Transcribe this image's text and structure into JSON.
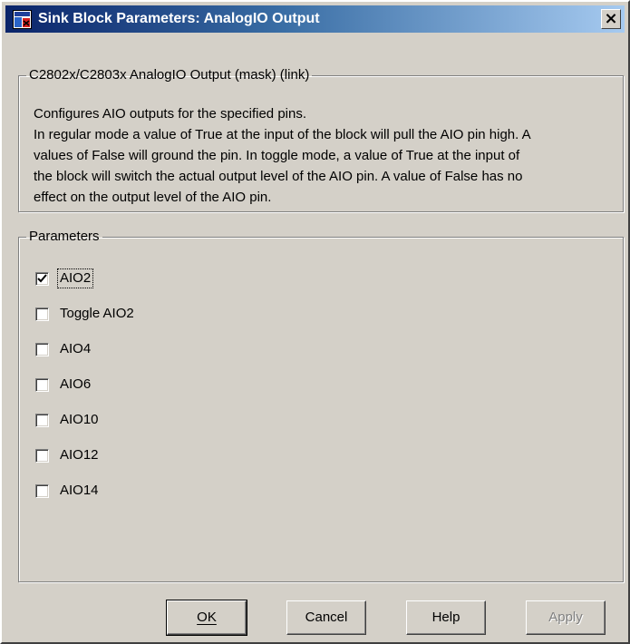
{
  "window": {
    "title": "Sink Block Parameters: AnalogIO Output",
    "close_label": "×"
  },
  "description": {
    "legend": "C2802x/C2803x AnalogIO Output (mask) (link)",
    "lines": [
      "Configures AIO outputs for the specified pins.",
      "In regular mode a value of True at the input of the block will pull the AIO pin high. A",
      "values of False will ground the pin. In toggle mode, a value of True at the input of",
      "the block will switch the actual output level of the AIO pin. A value of False has no",
      "effect on the output level of the AIO pin."
    ]
  },
  "parameters": {
    "legend": "Parameters",
    "checkboxes": [
      {
        "label": "AIO2",
        "checked": true
      },
      {
        "label": "Toggle AIO2",
        "checked": false
      },
      {
        "label": "AIO4",
        "checked": false
      },
      {
        "label": "AIO6",
        "checked": false
      },
      {
        "label": "AIO10",
        "checked": false
      },
      {
        "label": "AIO12",
        "checked": false
      },
      {
        "label": "AIO14",
        "checked": false
      }
    ]
  },
  "buttons": {
    "ok": "OK",
    "cancel": "Cancel",
    "help": "Help",
    "apply": "Apply"
  }
}
